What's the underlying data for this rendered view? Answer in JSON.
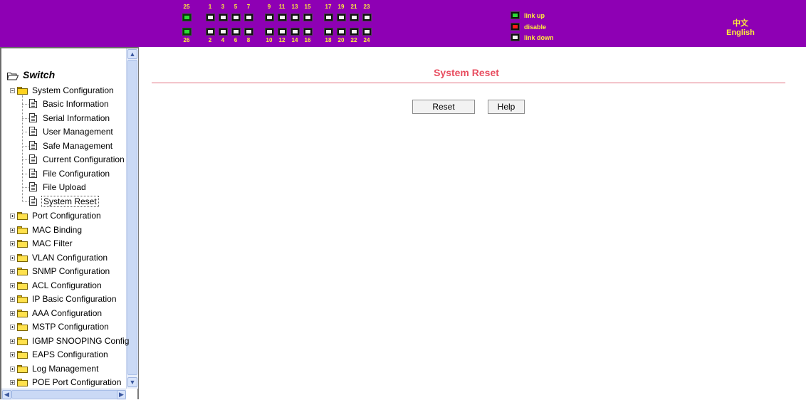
{
  "banner": {
    "background": "#8e00b4",
    "label_color": "#ffee3a",
    "uplink_top": "25",
    "uplink_bottom": "26",
    "top_numbers": [
      "1",
      "3",
      "5",
      "7",
      "9",
      "11",
      "13",
      "15",
      "17",
      "19",
      "21",
      "23"
    ],
    "bottom_numbers": [
      "2",
      "4",
      "6",
      "8",
      "10",
      "12",
      "14",
      "16",
      "18",
      "20",
      "22",
      "24"
    ],
    "legend": [
      {
        "icon": "port-link-up-icon",
        "label": "link up"
      },
      {
        "icon": "port-disable-icon",
        "label": "disable"
      },
      {
        "icon": "port-link-down-icon",
        "label": "link down"
      }
    ],
    "lang_chinese": "中文",
    "lang_english": "English"
  },
  "tree": {
    "root": "Switch",
    "expanded_group": "System Configuration",
    "children": [
      "Basic Information",
      "Serial Information",
      "User Management",
      "Safe Management",
      "Current Configuration",
      "File Configuration",
      "File Upload",
      "System Reset"
    ],
    "selected": "System Reset",
    "groups": [
      "Port Configuration",
      "MAC Binding",
      "MAC Filter",
      "VLAN Configuration",
      "SNMP Configuration",
      "ACL Configuration",
      "IP Basic Configuration",
      "AAA Configuration",
      "MSTP Configuration",
      "IGMP SNOOPING Config",
      "EAPS Configuration",
      "Log Management",
      "POE Port Configuration"
    ]
  },
  "main": {
    "title": "System Reset",
    "title_color": "#e84e60",
    "reset_button": "Reset",
    "help_button": "Help"
  }
}
